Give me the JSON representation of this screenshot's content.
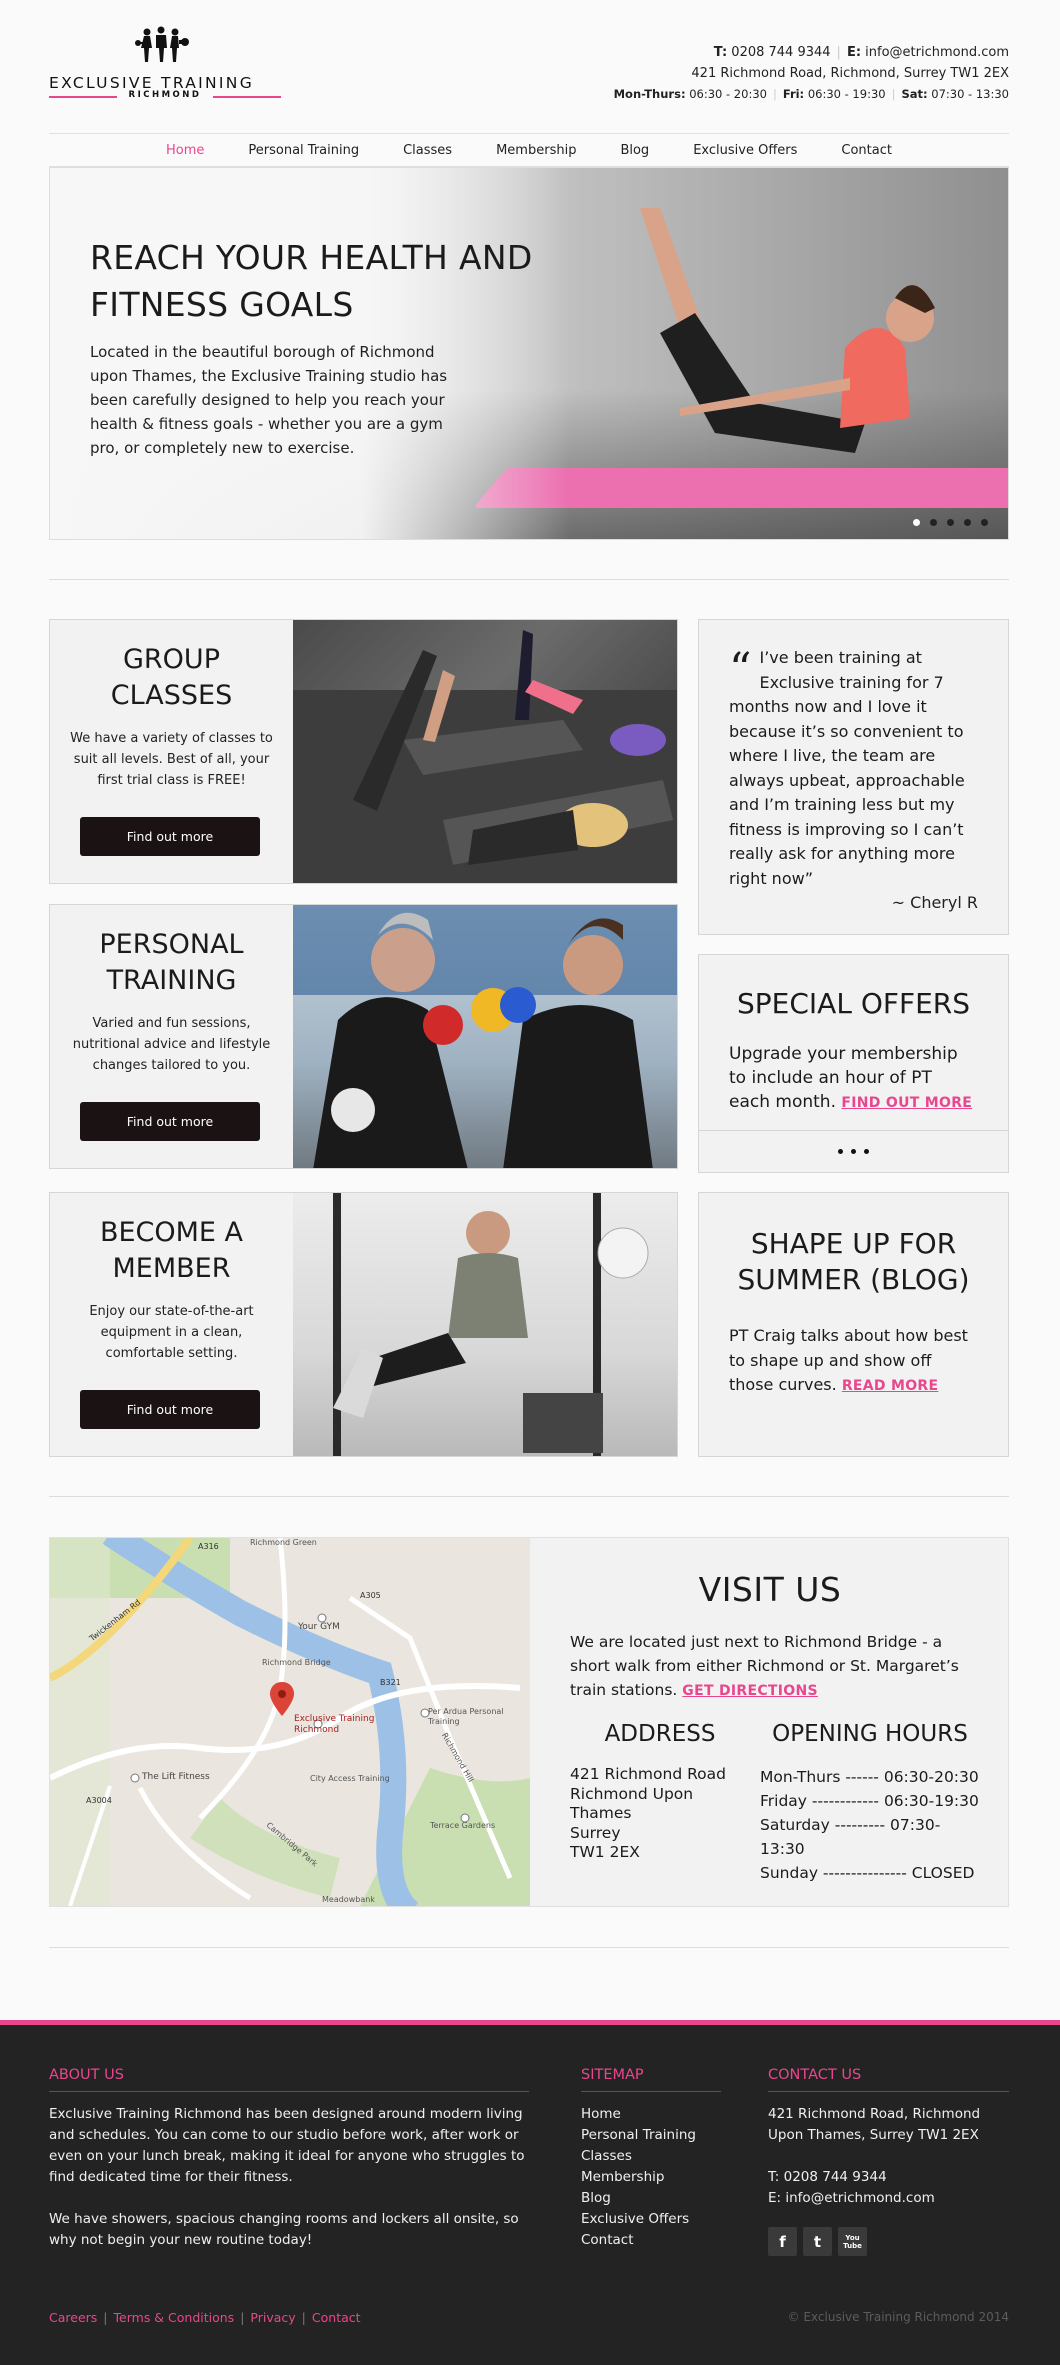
{
  "brand": {
    "name": "EXCLUSIVE TRAINING",
    "sub": "RICHMOND",
    "accent": "#e8478e"
  },
  "top_contact": {
    "phone_label": "T:",
    "phone": "0208 744 9344",
    "email_label": "E:",
    "email": "info@etrichmond.com",
    "address": "421 Richmond Road, Richmond, Surrey TW1 2EX",
    "hours_1_label": "Mon-Thurs:",
    "hours_1": "06:30 - 20:30",
    "hours_2_label": "Fri:",
    "hours_2": "06:30 - 19:30",
    "hours_3_label": "Sat:",
    "hours_3": "07:30 - 13:30"
  },
  "nav": {
    "items": [
      "Home",
      "Personal Training",
      "Classes",
      "Membership",
      "Blog",
      "Exclusive Offers",
      "Contact"
    ]
  },
  "hero": {
    "title": "REACH YOUR HEALTH AND FITNESS GOALS",
    "text": "Located in the beautiful borough of Richmond upon Thames, the Exclusive Training studio has been carefully designed to help you reach your health & fitness goals - whether you are a gym pro, or completely new to exercise.",
    "slide_count": 5,
    "active_slide": 1
  },
  "cards": [
    {
      "title": "GROUP CLASSES",
      "text": "We have a variety of classes to suit all levels. Best of all, your first trial class is FREE!",
      "button": "Find out more"
    },
    {
      "title": "PERSONAL TRAINING",
      "text": "Varied and fun sessions, nutritional advice and lifestyle changes tailored to you.",
      "button": "Find out more"
    },
    {
      "title": "BECOME A MEMBER",
      "text": "Enjoy our state-of-the-art equipment in a clean, comfortable setting.",
      "button": "Find out more"
    }
  ],
  "testimonial": {
    "mark": "“",
    "text": "I’ve been training at Exclusive training for 7 months now and I love it because it’s so convenient to where I live, the team are always upbeat, approachable and I’m training less but my fitness is improving so I can’t really ask for anything more right now”",
    "author": "~ Cheryl R"
  },
  "offers": {
    "title": "SPECIAL OFFERS",
    "text": "Upgrade your membership to include an hour of PT each month.",
    "link": "FIND OUT MORE"
  },
  "blog": {
    "title": "SHAPE UP FOR SUMMER (BLOG)",
    "text": "PT Craig talks about how best to shape up and show off those curves.",
    "link": "READ MORE"
  },
  "map": {
    "labels": {
      "gym": "Your GYM",
      "pin": "Exclusive Training Richmond",
      "bridge": "Richmond Bridge",
      "lift": "The Lift Fitness",
      "city": "City Access Training",
      "perardua": "Per Ardua Personal Training",
      "twick": "Twickenham Rd",
      "richmond_green": "Richmond Green",
      "a316": "A316",
      "a305": "A305",
      "a3004": "A3004",
      "b321": "B321",
      "terrace": "Terrace Gardens",
      "hill": "Richmond Hill",
      "meadowbank": "Meadowbank",
      "cambridge": "Cambridge Park"
    }
  },
  "visit": {
    "title": "VISIT US",
    "text": "We are located just next to Richmond Bridge - a short walk from either Richmond or St. Margaret’s train stations.",
    "link": "GET DIRECTIONS",
    "address_title": "ADDRESS",
    "address_lines": [
      "421 Richmond Road",
      "Richmond Upon Thames",
      "Surrey",
      "TW1 2EX"
    ],
    "hours_title": "OPENING HOURS",
    "hours_lines": [
      "Mon-Thurs ------ 06:30-20:30",
      "Friday ------------ 06:30-19:30",
      "Saturday --------- 07:30-13:30",
      "Sunday --------------- CLOSED"
    ]
  },
  "footer": {
    "about_title": "ABOUT US",
    "about_p1": "Exclusive Training Richmond has been designed around modern living and schedules. You can come to our studio before work, after work or even on your lunch break, making it ideal for anyone who struggles to find dedicated time for their fitness.",
    "about_p2": "We have showers, spacious changing rooms and lockers all onsite, so why not begin your new routine today!",
    "sitemap_title": "SITEMAP",
    "sitemap": [
      "Home",
      "Personal Training",
      "Classes",
      "Membership",
      "Blog",
      "Exclusive Offers",
      "Contact"
    ],
    "contact_title": "CONTACT US",
    "contact_address": "421 Richmond Road, Richmond Upon Thames, Surrey TW1 2EX",
    "contact_phone": "T: 0208 744 9344",
    "contact_email": "E: info@etrichmond.com",
    "social": [
      "f",
      "t",
      "You Tube"
    ],
    "bottom_links": [
      "Careers",
      "Terms & Conditions",
      "Privacy",
      "Contact"
    ],
    "copyright": "© Exclusive Training Richmond 2014"
  }
}
